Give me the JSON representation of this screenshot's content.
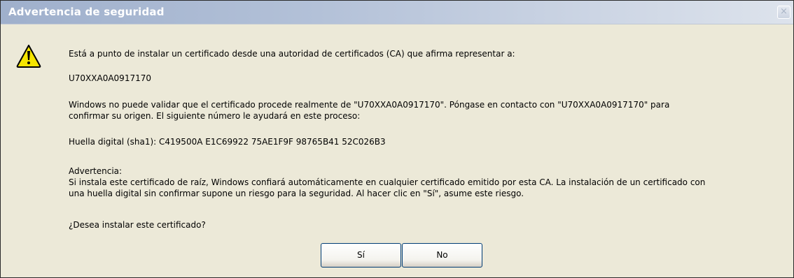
{
  "dialog": {
    "title": "Advertencia de seguridad",
    "close_label": "×"
  },
  "icon": {
    "name": "warning-icon",
    "fill_color": "#f5e500",
    "border_color": "#000000"
  },
  "message": {
    "intro": "Está a punto de instalar un certificado desde una autoridad de certificados (CA) que afirma representar a:",
    "ca_name": "U70XXA0A0917170",
    "validation_line1": "Windows no puede validar que el certificado procede realmente de \"U70XXA0A0917170\". Póngase en contacto con \"U70XXA0A0917170\" para",
    "validation_line2": "confirmar su origen. El siguiente número le ayudará en este proceso:",
    "thumbprint": "Huella digital (sha1): C419500A E1C69922 75AE1F9F 98765B41 52C026B3",
    "warning_heading": "Advertencia:",
    "warning_line1": "Si instala este certificado de raíz, Windows confiará automáticamente en cualquier certificado emitido por esta CA. La instalación de un certificado con",
    "warning_line2": "una huella digital sin confirmar supone un riesgo para la seguridad. Al hacer clic en \"Sí\", asume este riesgo.",
    "question": "¿Desea instalar este certificado?"
  },
  "buttons": {
    "yes_label": "Sí",
    "no_label": "No"
  },
  "colors": {
    "dialog_background": "#ece9d8",
    "titlebar_start": "#9fb0cc",
    "button_border": "#003c74"
  }
}
